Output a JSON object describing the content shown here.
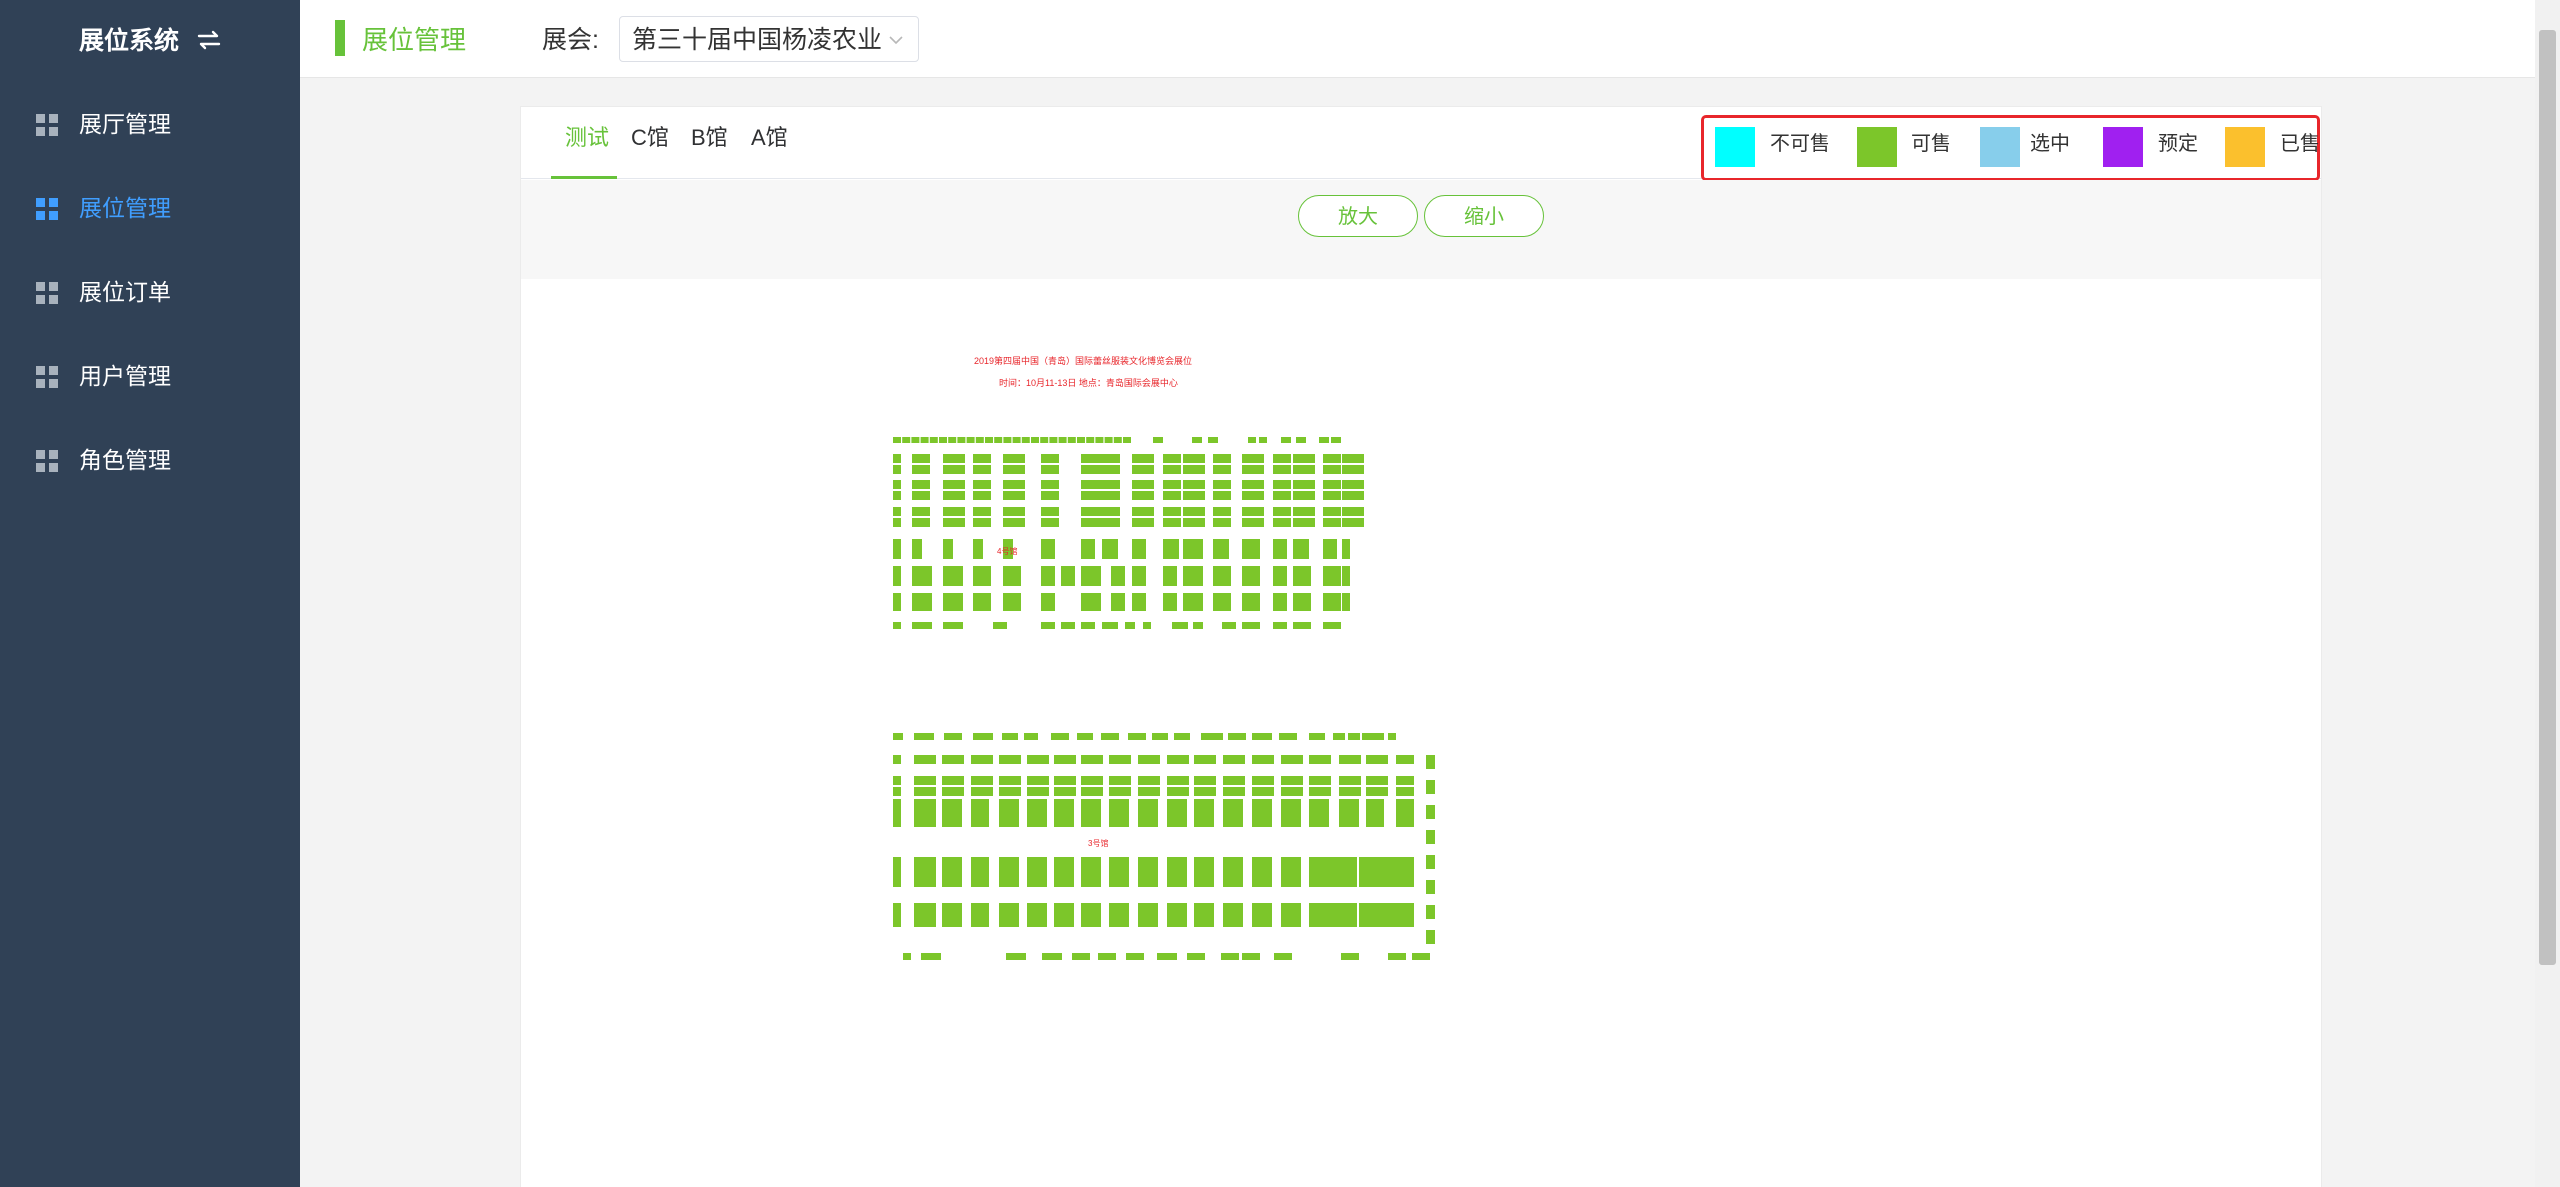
{
  "sidebar": {
    "brand_title": "展位系统",
    "toggle_icon": "toggle-icon",
    "items": [
      {
        "label": "展厅管理",
        "icon": "grid-icon",
        "active": false
      },
      {
        "label": "展位管理",
        "icon": "grid-icon",
        "active": true
      },
      {
        "label": "展位订单",
        "icon": "grid-icon",
        "active": false
      },
      {
        "label": "用户管理",
        "icon": "grid-icon",
        "active": false
      },
      {
        "label": "角色管理",
        "icon": "grid-icon",
        "active": false
      }
    ]
  },
  "header": {
    "title": "展位管理",
    "exhibition_label": "展会:",
    "exhibition_value": "第三十届中国杨凌农业"
  },
  "tabs": [
    {
      "label": "测试",
      "active": true
    },
    {
      "label": "C馆",
      "active": false
    },
    {
      "label": "B馆",
      "active": false
    },
    {
      "label": "A馆",
      "active": false
    }
  ],
  "legend": [
    {
      "label": "不可售",
      "color": "#00ffff"
    },
    {
      "label": "可售",
      "color": "#7cc62a"
    },
    {
      "label": "选中",
      "color": "#87ceeb"
    },
    {
      "label": "预定",
      "color": "#a020f0"
    },
    {
      "label": "已售",
      "color": "#fbc02d"
    }
  ],
  "zoom": {
    "zoom_in": "放大",
    "zoom_out": "缩小"
  },
  "map": {
    "caption_line1": "2019第四届中国（青岛）国际蕾丝服装文化博览会展位",
    "caption_line2": "时间：10月11-13日 地点：青岛国际会展中心",
    "hall1_label": "4号馆",
    "hall2_label": "3号馆",
    "booth_color": "#7cc62a"
  }
}
